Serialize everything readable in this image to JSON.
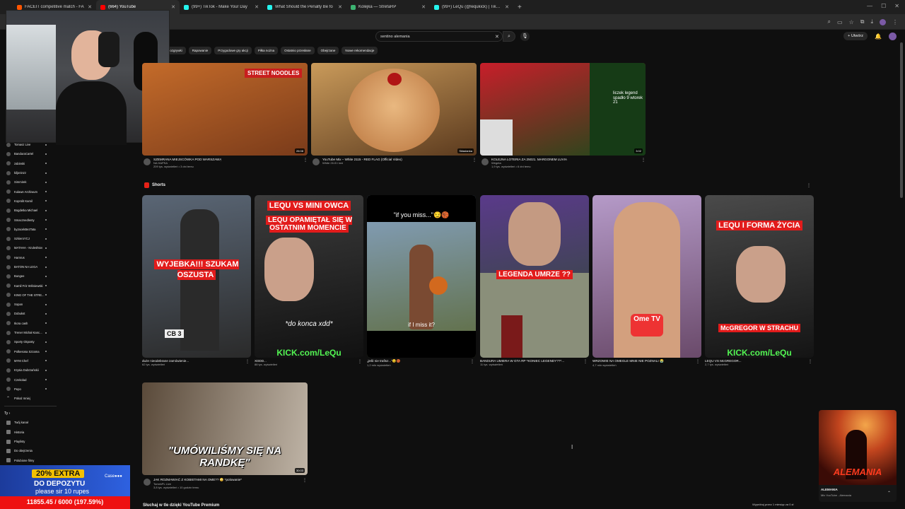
{
  "tabs": [
    {
      "label": "FACEIT competitive match - FA",
      "color": "#ff5500",
      "active": false
    },
    {
      "label": "(664) YouTube",
      "color": "#ff0000",
      "active": true
    },
    {
      "label": "(99+) TikTok - Make Your Day",
      "color": "#25f4ee",
      "active": false
    },
    {
      "label": "What Should the Penalty Be fo",
      "color": "#25f4ee",
      "active": false
    },
    {
      "label": "Kolejka — StrefaRP",
      "color": "#3cb371",
      "active": false
    },
    {
      "label": "(99+) LeQu (@lequkick) | TikTok",
      "color": "#25f4ee",
      "active": false
    }
  ],
  "search": {
    "query": "sentino alemania"
  },
  "header": {
    "create_label": "Utwórz"
  },
  "chips": [
    "Rozgrywki",
    "Rapowanie",
    "Przygodowe gry akcji",
    "Piłka nożna",
    "Ostatnio przesłane",
    "Obejrzane",
    "Nowe rekomendacje"
  ],
  "sidebar": {
    "items": [
      "Tomasz Live",
      "BanduraCartel",
      "zabinski",
      "kiljoninzz",
      "Simmirek",
      "Kulawe Archiwum",
      "Koprolit Kamil",
      "Bogdetka Michael",
      "Smacznedlenty",
      "byJacekBezTata",
      "SzkieroYCJ",
      "MATAHA - Kruleshtov",
      "Hamrus",
      "BATON NA LEGA",
      "Bungee",
      "Kamil Friz Wiśniewski",
      "KING OF THE STRE...",
      "Sopan",
      "Dobukst",
      "Ikora cash",
      "Trener Michał Kanc...",
      "Sporty Gkposty",
      "Polkesosa Szzama",
      "MYM Chef",
      "Krysia Dubrzańskii",
      "Czekolad",
      "Pepo",
      "Pokaż mniej"
    ],
    "you_title": "Ty",
    "you_items": [
      "Twój kanał",
      "Historia",
      "Playlisty",
      "Do obejrzenia",
      "Polubione filmy"
    ]
  },
  "videos": [
    {
      "title": "SZEMRANA MIEJSCÓWKA POD WARSZAWĄ",
      "channel": "NA HAPSA",
      "meta": "209 tys. wyświetleń • 3 dni temu",
      "duration": "26:08",
      "colors": [
        "#c46b2a",
        "#7a3b1a"
      ]
    },
    {
      "title": "YouTube Mix – White 2115 - RED FLAG (Official Video)",
      "channel": "White 2115 i inni",
      "meta": "",
      "duration": "Składanka",
      "colors": [
        "#c99a5a",
        "#5b3a1e"
      ]
    },
    {
      "title": "KOLEJNA LOTERIA ZA 25021. MARGONEM LUVIA",
      "channel": "Wegeta",
      "meta": "1,9 tys. wyświetleń • 6 dni temu",
      "duration": "3:02",
      "overlay": "liczek legend spadło 9 wtorek 21",
      "colors": [
        "#c81e2a",
        "#1a4a1a"
      ]
    }
  ],
  "shorts_title": "Shorts",
  "shorts": [
    {
      "title": "duże nieodebrane zamówienie...",
      "meta": "62 tys. wyświetleń",
      "caption": "WYJEBKA!!! SZUKAM OSZUSTA",
      "plate": "CB 3",
      "colors": [
        "#5a6675",
        "#2a2a2a"
      ]
    },
    {
      "title": "XDDD...",
      "meta": "88 tys. wyświetleń",
      "caption": "LEQU VS MINI OWCA",
      "caption2": "LEQU OPAMIĘTAŁ SIĘ W OSTATNIM MOMENCIE",
      "sub": "*do konca xdd*",
      "kick": "KICK.com/LeQu",
      "colors": [
        "#3c3c3c",
        "#111"
      ]
    },
    {
      "title": "„jeśli nie trafisz...\"😏🏀",
      "meta": "1,2 mln wyświetleń",
      "caption": "\"if you miss...\"😏🏀",
      "sub": "if I miss it?",
      "colors": [
        "#86a3c5",
        "#5d6a3a"
      ]
    },
    {
      "title": "BANDURA UMIERA W GTA RP *KONIEC LEGENDY??*...",
      "meta": "11 tys. wyświetleń",
      "caption": "LEGENDA UMRZE ??",
      "colors": [
        "#5a3a8a",
        "#2b4b2b"
      ]
    },
    {
      "title": "WRZOWIE NA OMEGLE MNIE NIE POZNALI 😭",
      "meta": "4,7 mln wyświetleń",
      "tv": "Ome TV",
      "colors": [
        "#b59ac8",
        "#6a4a6a"
      ]
    },
    {
      "title": "LEQU VS McGREGOR...",
      "meta": "2,7 tys. wyświetleń",
      "caption": "LEQU I FORMA ŻYCIA",
      "sub": "McGREGOR W STRACHU",
      "kick": "KICK.com/LeQu",
      "colors": [
        "#4a4a4a",
        "#141414"
      ]
    }
  ],
  "video4": {
    "title": "JAK ROZMAWIAĆ Z KOBIETAMI NA OME?? 😳 *polowanie*",
    "channel": "TomekPL Live",
    "meta": "3,8 tys. wyświetleń • 10 godzin temu",
    "duration": "30:03",
    "caption": "\"UMÓWILIŚMY SIĘ NA RANDKĘ\"",
    "colors": [
      "#bfb4a6",
      "#5a4a3a"
    ]
  },
  "bottom_section": "Słuchaj w tle dzięki YouTube Premium",
  "bottom_right": "Wypróbuj przez 1 miesiąc za 0 zł",
  "promo": {
    "badge": "20% EXTRA",
    "sub": "DO DEPOZYTU",
    "note": "please sir 10 rupes",
    "brand": "Case●●●",
    "counter": "11855.45 / 6000 (197.59%)",
    "progress": 1.0
  },
  "miniplayer": {
    "title": "ALEMANIA",
    "subtitle": "Mix YouTube - Alemania",
    "art_text": "ALEMANIA"
  }
}
